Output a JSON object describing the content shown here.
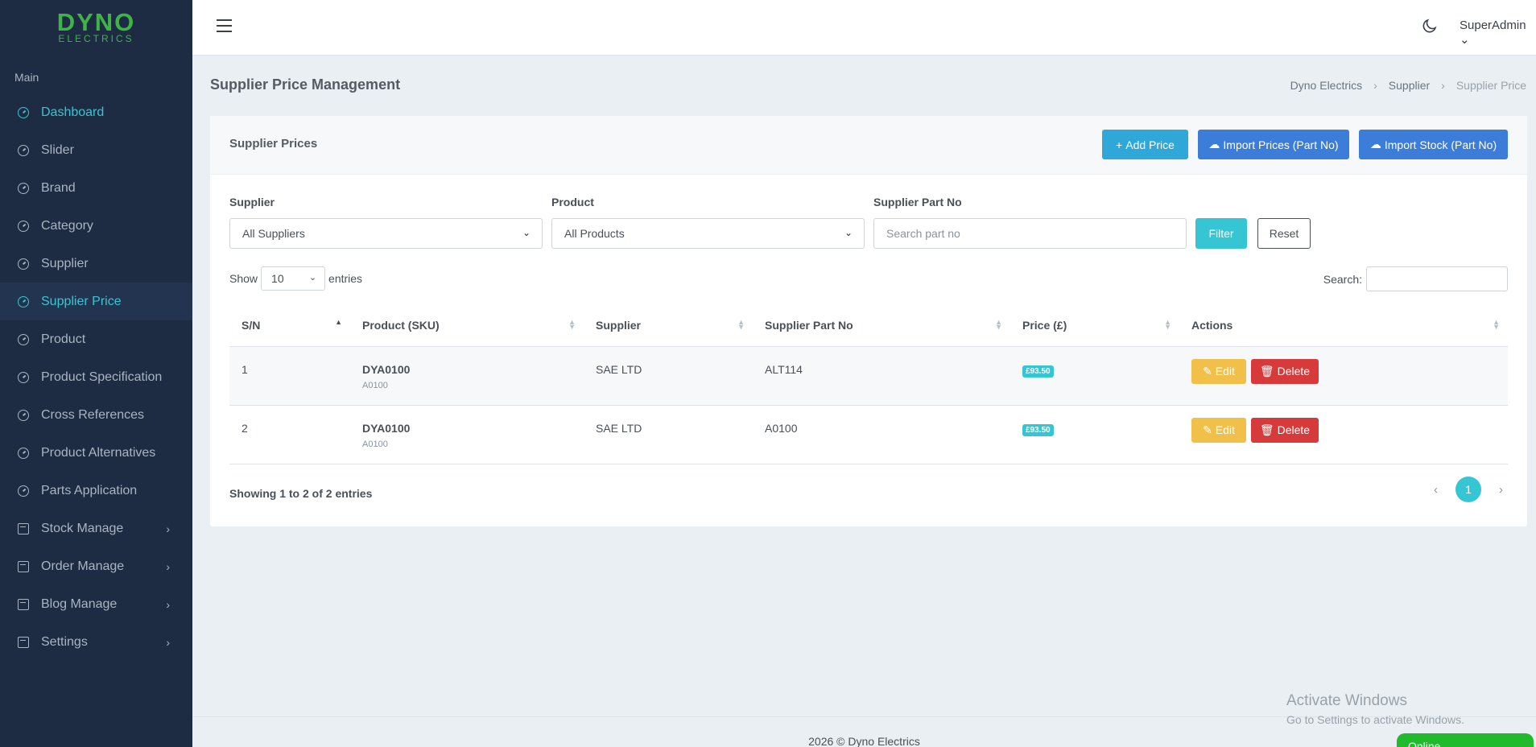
{
  "logo": {
    "line1": "DYNO",
    "line2": "ELECTRICS"
  },
  "sidebar": {
    "section": "Main",
    "items": [
      {
        "label": "Dashboard"
      },
      {
        "label": "Slider"
      },
      {
        "label": "Brand"
      },
      {
        "label": "Category"
      },
      {
        "label": "Supplier"
      },
      {
        "label": "Supplier Price"
      },
      {
        "label": "Product"
      },
      {
        "label": "Product Specification"
      },
      {
        "label": "Cross References"
      },
      {
        "label": "Product Alternatives"
      },
      {
        "label": "Parts Application"
      },
      {
        "label": "Stock Manage"
      },
      {
        "label": "Order Manage"
      },
      {
        "label": "Blog Manage"
      },
      {
        "label": "Settings"
      }
    ]
  },
  "topbar": {
    "user": "SuperAdmin"
  },
  "page": {
    "title": "Supplier Price Management"
  },
  "breadcrumb": [
    "Dyno Electrics",
    "Supplier",
    "Supplier Price"
  ],
  "card": {
    "title": "Supplier Prices",
    "add_btn": "Add Price",
    "import_prices_btn": "Import Prices (Part No)",
    "import_stock_btn": "Import Stock (Part No)"
  },
  "filters": {
    "supplier_label": "Supplier",
    "supplier_value": "All Suppliers",
    "product_label": "Product",
    "product_value": "All Products",
    "partno_label": "Supplier Part No",
    "partno_placeholder": "Search part no",
    "filter_btn": "Filter",
    "reset_btn": "Reset"
  },
  "table_controls": {
    "show": "Show",
    "length": "10",
    "entries": "entries",
    "search": "Search:"
  },
  "table": {
    "columns": [
      "S/N",
      "Product (SKU)",
      "Supplier",
      "Supplier Part No",
      "Price (£)",
      "Actions"
    ],
    "rows": [
      {
        "sn": "1",
        "product": "DYA0100",
        "sku": "A0100",
        "supplier": "SAE LTD",
        "part_no": "ALT114",
        "price": "£93.50"
      },
      {
        "sn": "2",
        "product": "DYA0100",
        "sku": "A0100",
        "supplier": "SAE LTD",
        "part_no": "A0100",
        "price": "£93.50"
      }
    ],
    "edit": "Edit",
    "delete": "Delete"
  },
  "pagination": {
    "info": "Showing 1 to 2 of 2 entries",
    "current": "1",
    "prev": "‹",
    "next": "›"
  },
  "footer": "2026 © Dyno Electrics",
  "watermark": {
    "line1": "Activate Windows",
    "line2": "Go to Settings to activate Windows."
  },
  "online": "Online",
  "colors": {
    "sidebar": "#1d2c42",
    "accent": "#36c6d3",
    "primary": "#3b7dd8",
    "warning": "#f0c04a",
    "danger": "#d63a3a"
  }
}
